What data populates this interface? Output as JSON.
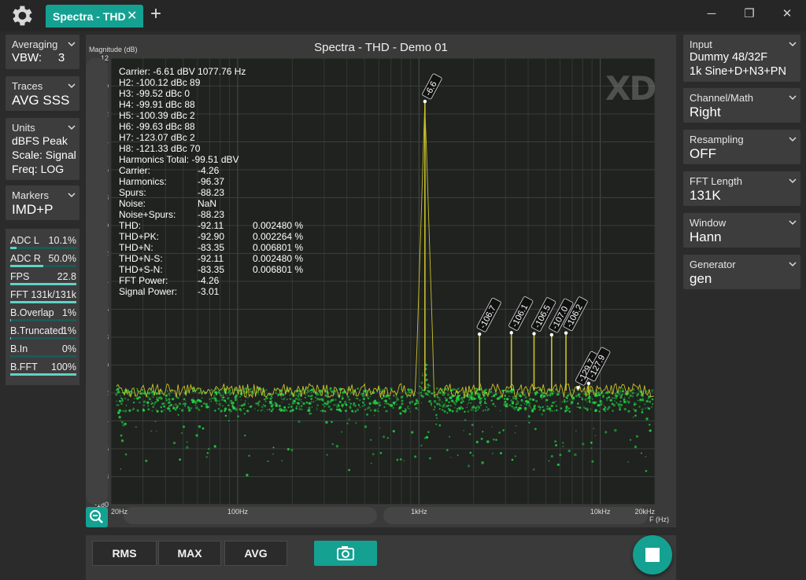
{
  "titlebar": {
    "settings_icon": "gear-icon",
    "tab_label": "Spectra - THD",
    "tab_close": "✕",
    "add_tab": "+",
    "window_controls": [
      "─",
      "❐",
      "✕"
    ]
  },
  "left_panels": [
    {
      "label": "Averaging",
      "value": "VBW:     3"
    },
    {
      "label": "Traces",
      "value": "AVG SSS"
    },
    {
      "label": "Units",
      "value_lines": [
        "dBFS Peak",
        "Scale: Signal",
        "Freq: LOG"
      ]
    },
    {
      "label": "Markers",
      "value": "IMD+P"
    }
  ],
  "meters": [
    {
      "label": "ADC L",
      "value": "10.1%",
      "level": 0.101
    },
    {
      "label": "ADC R",
      "value": "50.0%",
      "level": 0.5
    },
    {
      "label": "FPS",
      "value": "22.8",
      "level": 1.0
    },
    {
      "label": "FFT",
      "value": "131k/131k",
      "level": 1.0
    },
    {
      "label": "B.Overlap",
      "value": "1%",
      "level": 0.01
    },
    {
      "label": "B.Truncated",
      "value": "1%",
      "level": 0.01
    },
    {
      "label": "B.In",
      "value": "0%",
      "level": 0.0
    },
    {
      "label": "B.FFT",
      "value": "100%",
      "level": 1.0
    }
  ],
  "right_panels": [
    {
      "label": "Input",
      "value_lines": [
        "Dummy 48/32F",
        "1k Sine+D+N3+PN"
      ]
    },
    {
      "label": "Channel/Math",
      "value": "Right"
    },
    {
      "label": "Resampling",
      "value": "OFF"
    },
    {
      "label": "FFT Length",
      "value": "131K"
    },
    {
      "label": "Window",
      "value": "Hann"
    },
    {
      "label": "Generator",
      "value": "gen"
    }
  ],
  "plot": {
    "title": "Spectra -  THD  - Demo 01",
    "watermark": "XD",
    "zoom_icon": "zoom-out-icon"
  },
  "stats": {
    "carrier_line": "Carrier: -6.61 dBV 1077.76 Hz",
    "harmonics": [
      "H2: -100.12 dBc  89",
      "H3: -99.52 dBc  0",
      "H4: -99.91 dBc  88",
      "H5: -100.39 dBc  2",
      "H6: -99.63 dBc  88",
      "H7: -123.07 dBc  2",
      "H8: -121.33 dBc  70"
    ],
    "harmonics_total": "Harmonics Total: -99.51 dBV",
    "rows": [
      {
        "name": "Carrier:",
        "db": "-4.26",
        "pct": ""
      },
      {
        "name": "Harmonics:",
        "db": "-96.37",
        "pct": ""
      },
      {
        "name": "Spurs:",
        "db": "-88.23",
        "pct": ""
      },
      {
        "name": "Noise:",
        "db": "NaN",
        "pct": ""
      },
      {
        "name": "Noise+Spurs:",
        "db": "-88.23",
        "pct": ""
      },
      {
        "name": "THD:",
        "db": "-92.11",
        "pct": "0.002480 %"
      },
      {
        "name": "THD+PK:",
        "db": "-92.90",
        "pct": "0.002264 %"
      },
      {
        "name": "THD+N:",
        "db": "-83.35",
        "pct": "0.006801 %"
      },
      {
        "name": "THD+N-S:",
        "db": "-92.11",
        "pct": "0.002480 %"
      },
      {
        "name": "THD+S-N:",
        "db": "-83.35",
        "pct": "0.006801 %"
      },
      {
        "name": "FFT Power:",
        "db": "-4.26",
        "pct": ""
      },
      {
        "name": "Signal Power:",
        "db": "-3.01",
        "pct": ""
      }
    ]
  },
  "chart_data": {
    "type": "line",
    "title": "Spectra -  THD  - Demo 01",
    "ylabel": "Magnitude (dB)",
    "xlabel": "F (Hz)",
    "ylim": [
      -180,
      12
    ],
    "xlim": [
      20,
      20000
    ],
    "x_scale": "log",
    "y_ticks": [
      12,
      0,
      -12,
      -24,
      -36,
      -48,
      -60,
      -72,
      -84,
      -96,
      -108,
      -120,
      -132,
      -144,
      -156,
      -168,
      -180
    ],
    "x_ticks": [
      {
        "value": 20,
        "label": "20Hz"
      },
      {
        "value": 100,
        "label": "100Hz"
      },
      {
        "value": 1000,
        "label": "1kHz"
      },
      {
        "value": 10000,
        "label": "10kHz"
      },
      {
        "value": 20000,
        "label": "20kHz"
      }
    ],
    "grid": true,
    "markers": [
      {
        "freq": 1078,
        "db": -6.6,
        "label": "-6.6"
      },
      {
        "freq": 2156,
        "db": -106.7,
        "label": "-106.7"
      },
      {
        "freq": 3233,
        "db": -106.1,
        "label": "-106.1"
      },
      {
        "freq": 4311,
        "db": -106.5,
        "label": "-106.5"
      },
      {
        "freq": 5389,
        "db": -107.0,
        "label": "-107.0"
      },
      {
        "freq": 6467,
        "db": -106.2,
        "label": "-106.2"
      },
      {
        "freq": 7544,
        "db": -129.7,
        "label": "-129.7"
      },
      {
        "freq": 8622,
        "db": -127.9,
        "label": "-127.9"
      }
    ],
    "series": [
      {
        "style": "trace-line",
        "color": "#c9c12a",
        "noise_floor_db": -131,
        "carrier_db": -6.6
      },
      {
        "style": "scatter-cloud",
        "color": "#22dd44",
        "floor_low_db": -140,
        "floor_high_db": -130
      }
    ]
  },
  "toolbar": {
    "rms": "RMS",
    "max": "MAX",
    "avg": "AVG",
    "camera_icon": "camera-icon",
    "stop_icon": "stop-icon"
  },
  "colors": {
    "accent": "#14a192",
    "trace": "#c9c12a",
    "scatter": "#22dd44",
    "plot_bg": "#1f221f"
  }
}
